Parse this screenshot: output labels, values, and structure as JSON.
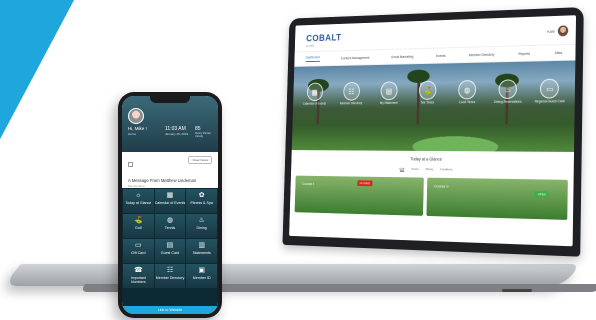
{
  "laptop": {
    "logo": "COBALT",
    "logo_sub": "CLUBS",
    "user_name": "Kate",
    "nav": [
      "Dashboard",
      "Content Management",
      "Email Marketing",
      "Events",
      "Member Directory",
      "Reports",
      "Sites"
    ],
    "hero_tiles": [
      {
        "label": "Calendar of Events",
        "icon": "calendar-icon"
      },
      {
        "label": "Member Directory",
        "icon": "people-icon"
      },
      {
        "label": "My Statement",
        "icon": "document-icon"
      },
      {
        "label": "Tee Times",
        "icon": "golf-icon"
      },
      {
        "label": "Court Times",
        "icon": "tennis-icon"
      },
      {
        "label": "Dining Reservations",
        "icon": "dining-icon"
      },
      {
        "label": "Regional Guest Card",
        "icon": "card-icon"
      }
    ],
    "glance_title": "Today at a Glance",
    "glance_tabs": [
      "Golf",
      "Tennis",
      "Dining",
      "Conditions"
    ],
    "cards": [
      {
        "name": "Course I",
        "badge": "CLOSED",
        "badge_color": "#d9261c"
      },
      {
        "name": "Course II",
        "badge": "OPEN",
        "badge_color": "#3fae49"
      }
    ]
  },
  "phone": {
    "greeting": "Hi, Mike !",
    "place": "Home",
    "time": "11:03 AM",
    "date": "January 25, 2019",
    "temp": "85",
    "weather_sub": "Sunny Partial Cloudy",
    "clear_label": "Clear News",
    "message_title": "A Message From Matthew Lindeman",
    "message_sub": "Membership",
    "grid": [
      {
        "label": "Today at Glance",
        "icon": "☼"
      },
      {
        "label": "Calendar of Events",
        "icon": "▦"
      },
      {
        "label": "Fitness & Spa",
        "icon": "✿"
      },
      {
        "label": "Golf",
        "icon": "⛳"
      },
      {
        "label": "Tennis",
        "icon": "◍"
      },
      {
        "label": "Dining",
        "icon": "♨"
      },
      {
        "label": "Gift Card",
        "icon": "▭"
      },
      {
        "label": "Guest Card",
        "icon": "▤"
      },
      {
        "label": "Statements",
        "icon": "▥"
      },
      {
        "label": "Important Numbers",
        "icon": "☎"
      },
      {
        "label": "Member Directory",
        "icon": "☷"
      },
      {
        "label": "Member ID",
        "icon": "▣"
      }
    ],
    "footer": "Link to Website"
  },
  "colors": {
    "accent": "#1ea7dd",
    "brand": "#2c5aa0",
    "closed": "#d9261c",
    "open": "#3fae49"
  }
}
